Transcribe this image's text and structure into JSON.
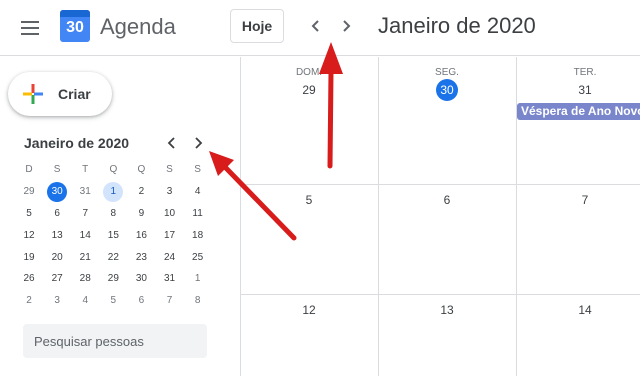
{
  "header": {
    "menu_icon": "menu-icon",
    "logo_number": "30",
    "app_title": "Agenda",
    "today_label": "Hoje",
    "prev_icon": "chevron-left-icon",
    "next_icon": "chevron-right-icon",
    "current_period": "Janeiro de 2020"
  },
  "sidebar": {
    "create_label": "Criar",
    "create_icon": "plus-icon",
    "mini_calendar": {
      "title": "Janeiro de 2020",
      "weekdays": [
        "D",
        "S",
        "T",
        "Q",
        "Q",
        "S",
        "S"
      ],
      "weeks": [
        [
          "29",
          "30",
          "31",
          "1",
          "2",
          "3",
          "4"
        ],
        [
          "5",
          "6",
          "7",
          "8",
          "9",
          "10",
          "11"
        ],
        [
          "12",
          "13",
          "14",
          "15",
          "16",
          "17",
          "18"
        ],
        [
          "19",
          "20",
          "21",
          "22",
          "23",
          "24",
          "25"
        ],
        [
          "26",
          "27",
          "28",
          "29",
          "30",
          "31",
          "1"
        ],
        [
          "2",
          "3",
          "4",
          "5",
          "6",
          "7",
          "8"
        ]
      ],
      "today": "30",
      "selected": "1"
    },
    "people_search_placeholder": "Pesquisar pessoas"
  },
  "grid": {
    "columns": [
      {
        "dow": "DOM.",
        "date": "29"
      },
      {
        "dow": "SEG.",
        "date": "30"
      },
      {
        "dow": "TER.",
        "date": "31"
      }
    ],
    "rows": [
      [
        "",
        "",
        ""
      ],
      [
        "5",
        "6",
        "7"
      ],
      [
        "12",
        "13",
        "14"
      ]
    ],
    "event": {
      "label": "Véspera de Ano Novo (a)",
      "color": "#7986cb"
    }
  },
  "colors": {
    "accent": "#1a73e8",
    "annotation_arrow": "#d81b1b",
    "event": "#7986cb"
  }
}
